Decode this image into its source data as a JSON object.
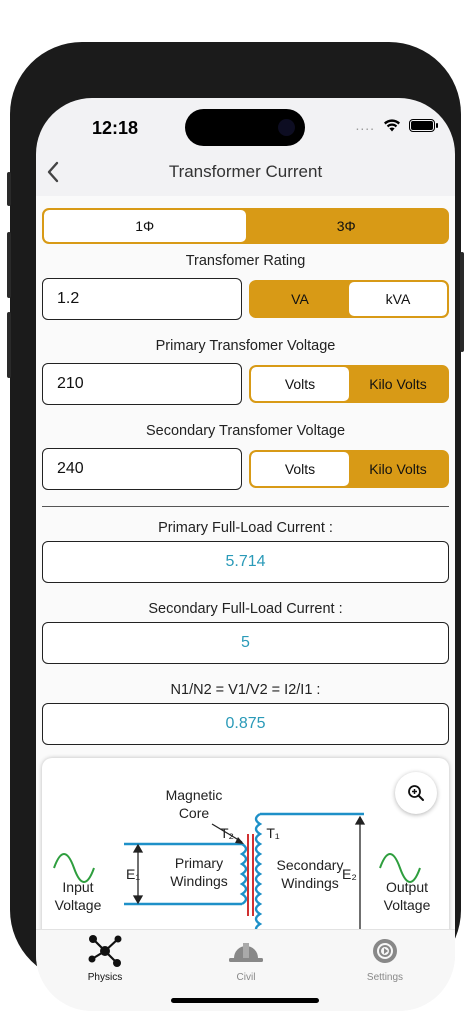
{
  "status": {
    "time": "12:18",
    "dots": "...."
  },
  "nav": {
    "title": "Transformer Current"
  },
  "phase": {
    "options": [
      "1Φ",
      "3Φ"
    ],
    "selected": "1Φ"
  },
  "rating": {
    "label": "Transfomer Rating",
    "value": "1.2",
    "units": [
      "VA",
      "kVA"
    ],
    "selected_unit": "kVA"
  },
  "primary_voltage": {
    "label": "Primary Transfomer Voltage",
    "value": "210",
    "units": [
      "Volts",
      "Kilo Volts"
    ],
    "selected_unit": "Volts"
  },
  "secondary_voltage": {
    "label": "Secondary Transfomer Voltage",
    "value": "240",
    "units": [
      "Volts",
      "Kilo Volts"
    ],
    "selected_unit": "Volts"
  },
  "results": {
    "primary": {
      "label": "Primary Full-Load Current :",
      "value": "5.714"
    },
    "secondary": {
      "label": "Secondary Full-Load Current :",
      "value": "5"
    },
    "ratio": {
      "label": "N1/N2 = V1/V2 = I2/I1 :",
      "value": "0.875"
    }
  },
  "diagram": {
    "magnetic_core": [
      "Magnetic",
      "Core"
    ],
    "input_voltage": [
      "Input",
      "Voltage"
    ],
    "output_voltage": [
      "Output",
      "Voltage"
    ],
    "primary_windings": [
      "Primary",
      "Windings"
    ],
    "secondary_windings": [
      "Secondary",
      "Windings"
    ],
    "e1": "E₁",
    "e2": "E₂",
    "t1": "T₁",
    "t2": "T₂"
  },
  "tabs": [
    {
      "label": "Physics",
      "icon": "molecule-icon",
      "active": true
    },
    {
      "label": "Civil",
      "icon": "hard-hat-icon",
      "active": false
    },
    {
      "label": "Settings",
      "icon": "gear-icon",
      "active": false
    }
  ],
  "colors": {
    "accent": "#D89A16",
    "result_text": "#2A9AB8",
    "wave": "#2E9E3E",
    "wire": "#1E90C8",
    "core": "#D03030"
  }
}
